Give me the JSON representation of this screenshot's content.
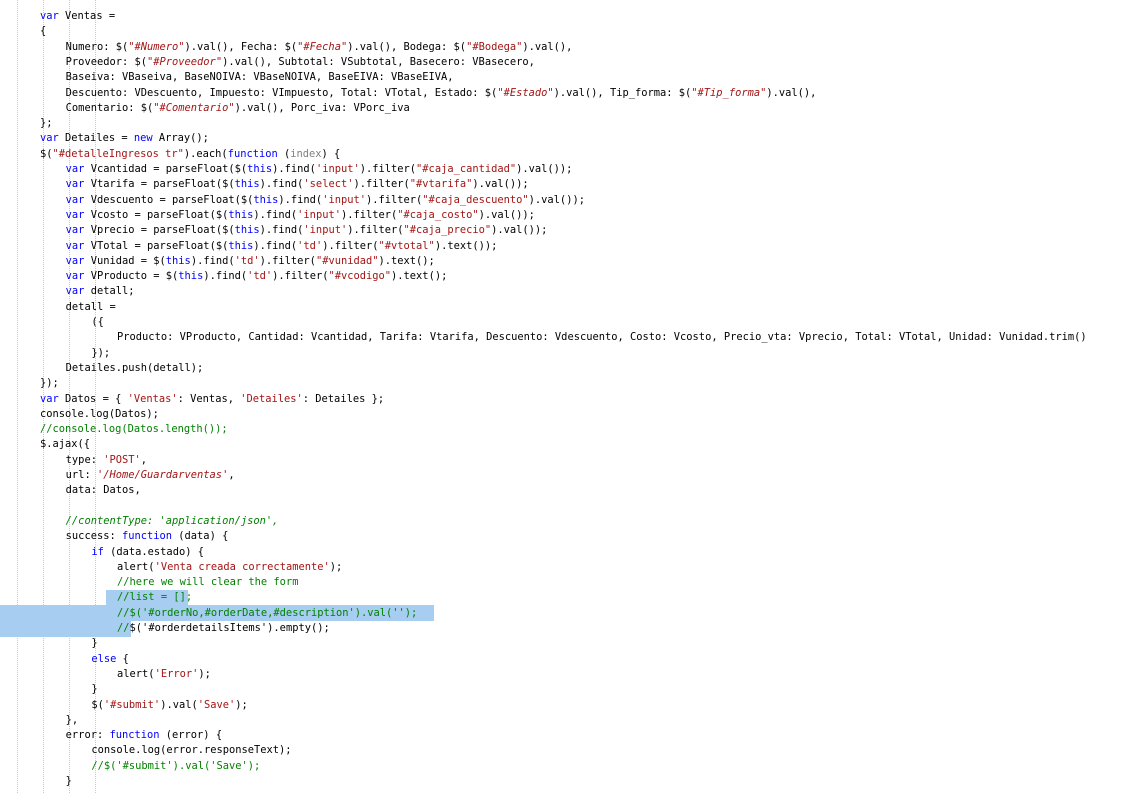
{
  "editor": {
    "language": "JavaScript",
    "colors": {
      "keyword": "#0000ff",
      "string": "#a31515",
      "comment": "#008000",
      "selection": "#a7cdf0",
      "background": "#ffffff"
    },
    "lines": [
      {
        "indent": 0,
        "t": [
          [
            "kw",
            "var"
          ],
          [
            "p",
            " Ventas ="
          ]
        ]
      },
      {
        "indent": 0,
        "t": [
          [
            "p",
            "{"
          ]
        ]
      },
      {
        "indent": 4,
        "t": [
          [
            "p",
            "Numero: $("
          ],
          [
            "sty",
            "\"#Numero\""
          ],
          [
            "p",
            ").val(), Fecha: $("
          ],
          [
            "sty",
            "\"#Fecha\""
          ],
          [
            "p",
            ").val(), Bodega: $("
          ],
          [
            "str",
            "\"#Bodega\""
          ],
          [
            "p",
            ").val(),"
          ]
        ]
      },
      {
        "indent": 4,
        "t": [
          [
            "p",
            "Proveedor: $("
          ],
          [
            "sty",
            "\"#Proveedor\""
          ],
          [
            "p",
            ").val(), Subtotal: VSubtotal, Basecero: VBasecero,"
          ]
        ]
      },
      {
        "indent": 4,
        "t": [
          [
            "p",
            "Baseiva: VBaseiva, BaseNOIVA: VBaseNOIVA, BaseEIVA: VBaseEIVA,"
          ]
        ]
      },
      {
        "indent": 4,
        "t": [
          [
            "p",
            "Descuento: VDescuento, Impuesto: VImpuesto, Total: VTotal, Estado: $("
          ],
          [
            "sty",
            "\"#Estado\""
          ],
          [
            "p",
            ").val(), Tip_forma: $("
          ],
          [
            "sty",
            "\"#Tip_forma\""
          ],
          [
            "p",
            ").val(),"
          ]
        ]
      },
      {
        "indent": 4,
        "t": [
          [
            "p",
            "Comentario: $("
          ],
          [
            "sty",
            "\"#Comentario\""
          ],
          [
            "p",
            ").val(), Porc_iva: VPorc_iva"
          ]
        ]
      },
      {
        "indent": 0,
        "t": [
          [
            "p",
            "};"
          ]
        ]
      },
      {
        "indent": 0,
        "t": [
          [
            "kw",
            "var"
          ],
          [
            "p",
            " Detailes = "
          ],
          [
            "kw",
            "new"
          ],
          [
            "p",
            " Array();"
          ]
        ]
      },
      {
        "indent": 0,
        "t": [
          [
            "p",
            "$("
          ],
          [
            "str",
            "\"#detalleIngresos tr\""
          ],
          [
            "p",
            ").each("
          ],
          [
            "kw",
            "function"
          ],
          [
            "p",
            " ("
          ],
          [
            "par",
            "index"
          ],
          [
            "p",
            ") {"
          ]
        ]
      },
      {
        "indent": 4,
        "t": [
          [
            "kw",
            "var"
          ],
          [
            "p",
            " Vcantidad = parseFloat($("
          ],
          [
            "kw",
            "this"
          ],
          [
            "p",
            ").find("
          ],
          [
            "str",
            "'input'"
          ],
          [
            "p",
            ").filter("
          ],
          [
            "str",
            "\"#caja_cantidad\""
          ],
          [
            "p",
            ").val());"
          ]
        ]
      },
      {
        "indent": 4,
        "t": [
          [
            "kw",
            "var"
          ],
          [
            "p",
            " Vtarifa = parseFloat($("
          ],
          [
            "kw",
            "this"
          ],
          [
            "p",
            ").find("
          ],
          [
            "str",
            "'select'"
          ],
          [
            "p",
            ").filter("
          ],
          [
            "str",
            "\"#vtarifa\""
          ],
          [
            "p",
            ").val());"
          ]
        ]
      },
      {
        "indent": 4,
        "t": [
          [
            "kw",
            "var"
          ],
          [
            "p",
            " Vdescuento = parseFloat($("
          ],
          [
            "kw",
            "this"
          ],
          [
            "p",
            ").find("
          ],
          [
            "str",
            "'input'"
          ],
          [
            "p",
            ").filter("
          ],
          [
            "str",
            "\"#caja_descuento\""
          ],
          [
            "p",
            ").val());"
          ]
        ]
      },
      {
        "indent": 4,
        "t": [
          [
            "kw",
            "var"
          ],
          [
            "p",
            " Vcosto = parseFloat($("
          ],
          [
            "kw",
            "this"
          ],
          [
            "p",
            ").find("
          ],
          [
            "str",
            "'input'"
          ],
          [
            "p",
            ").filter("
          ],
          [
            "str",
            "\"#caja_costo\""
          ],
          [
            "p",
            ").val());"
          ]
        ]
      },
      {
        "indent": 4,
        "t": [
          [
            "kw",
            "var"
          ],
          [
            "p",
            " Vprecio = parseFloat($("
          ],
          [
            "kw",
            "this"
          ],
          [
            "p",
            ").find("
          ],
          [
            "str",
            "'input'"
          ],
          [
            "p",
            ").filter("
          ],
          [
            "str",
            "\"#caja_precio\""
          ],
          [
            "p",
            ").val());"
          ]
        ]
      },
      {
        "indent": 4,
        "t": [
          [
            "kw",
            "var"
          ],
          [
            "p",
            " VTotal = parseFloat($("
          ],
          [
            "kw",
            "this"
          ],
          [
            "p",
            ").find("
          ],
          [
            "str",
            "'td'"
          ],
          [
            "p",
            ").filter("
          ],
          [
            "str",
            "\"#vtotal\""
          ],
          [
            "p",
            ").text());"
          ]
        ]
      },
      {
        "indent": 4,
        "t": [
          [
            "kw",
            "var"
          ],
          [
            "p",
            " Vunidad = $("
          ],
          [
            "kw",
            "this"
          ],
          [
            "p",
            ").find("
          ],
          [
            "str",
            "'td'"
          ],
          [
            "p",
            ").filter("
          ],
          [
            "str",
            "\"#vunidad\""
          ],
          [
            "p",
            ").text();"
          ]
        ]
      },
      {
        "indent": 4,
        "t": [
          [
            "kw",
            "var"
          ],
          [
            "p",
            " VProducto = $("
          ],
          [
            "kw",
            "this"
          ],
          [
            "p",
            ").find("
          ],
          [
            "str",
            "'td'"
          ],
          [
            "p",
            ").filter("
          ],
          [
            "str",
            "\"#vcodigo\""
          ],
          [
            "p",
            ").text();"
          ]
        ]
      },
      {
        "indent": 4,
        "t": [
          [
            "kw",
            "var"
          ],
          [
            "p",
            " detall;"
          ]
        ]
      },
      {
        "indent": 4,
        "t": [
          [
            "p",
            "detall ="
          ]
        ]
      },
      {
        "indent": 8,
        "t": [
          [
            "p",
            "({"
          ]
        ]
      },
      {
        "indent": 12,
        "t": [
          [
            "p",
            "Producto: VProducto, Cantidad: Vcantidad, Tarifa: Vtarifa, Descuento: Vdescuento, Costo: Vcosto, Precio_vta: Vprecio, Total: VTotal, Unidad: Vunidad.trim()"
          ]
        ]
      },
      {
        "indent": 8,
        "t": [
          [
            "p",
            "});"
          ]
        ]
      },
      {
        "indent": 4,
        "t": [
          [
            "p",
            "Detailes.push(detall);"
          ]
        ]
      },
      {
        "indent": 0,
        "t": [
          [
            "p",
            "});"
          ]
        ]
      },
      {
        "indent": 0,
        "t": [
          [
            "kw",
            "var"
          ],
          [
            "p",
            " Datos = { "
          ],
          [
            "str",
            "'Ventas'"
          ],
          [
            "p",
            ": Ventas, "
          ],
          [
            "str",
            "'Detailes'"
          ],
          [
            "p",
            ": Detailes };"
          ]
        ]
      },
      {
        "indent": 0,
        "t": [
          [
            "p",
            "console.log(Datos);"
          ]
        ]
      },
      {
        "indent": 0,
        "t": [
          [
            "cm",
            "//console.log(Datos.length());"
          ]
        ]
      },
      {
        "indent": 0,
        "t": [
          [
            "p",
            "$.ajax({"
          ]
        ]
      },
      {
        "indent": 4,
        "t": [
          [
            "p",
            "type: "
          ],
          [
            "str",
            "'POST'"
          ],
          [
            "p",
            ","
          ]
        ]
      },
      {
        "indent": 4,
        "t": [
          [
            "p",
            "url: "
          ],
          [
            "sty",
            "'/Home/Guardarventas'"
          ],
          [
            "p",
            ","
          ]
        ]
      },
      {
        "indent": 4,
        "t": [
          [
            "p",
            "data: Datos,"
          ]
        ]
      },
      {
        "indent": 0,
        "t": []
      },
      {
        "indent": 4,
        "t": [
          [
            "cmi",
            "//contentType: 'application/json',"
          ]
        ]
      },
      {
        "indent": 4,
        "t": [
          [
            "p",
            "success: "
          ],
          [
            "kw",
            "function"
          ],
          [
            "p",
            " (data) {"
          ]
        ]
      },
      {
        "indent": 8,
        "t": [
          [
            "kw",
            "if"
          ],
          [
            "p",
            " (data.estado) {"
          ]
        ]
      },
      {
        "indent": 12,
        "t": [
          [
            "p",
            "alert("
          ],
          [
            "str",
            "'Venta creada correctamente'"
          ],
          [
            "p",
            ");"
          ]
        ]
      },
      {
        "indent": 12,
        "t": [
          [
            "cm",
            "//here we will clear the form"
          ]
        ]
      },
      {
        "indent": 12,
        "t": [
          [
            "cm",
            "//list = [];"
          ]
        ]
      },
      {
        "indent": 12,
        "t": [
          [
            "cm",
            "//$('#orderNo,#orderDate,#description').val('');"
          ]
        ]
      },
      {
        "indent": 12,
        "t": [
          [
            "cm",
            "//"
          ],
          [
            "p",
            "$('#orderdetailsItems').empty();"
          ]
        ]
      },
      {
        "indent": 8,
        "t": [
          [
            "p",
            "}"
          ]
        ]
      },
      {
        "indent": 8,
        "t": [
          [
            "kw",
            "else"
          ],
          [
            "p",
            " {"
          ]
        ]
      },
      {
        "indent": 12,
        "t": [
          [
            "p",
            "alert("
          ],
          [
            "str",
            "'Error'"
          ],
          [
            "p",
            ");"
          ]
        ]
      },
      {
        "indent": 8,
        "t": [
          [
            "p",
            "}"
          ]
        ]
      },
      {
        "indent": 8,
        "t": [
          [
            "p",
            "$("
          ],
          [
            "str",
            "'#submit'"
          ],
          [
            "p",
            ").val("
          ],
          [
            "str",
            "'Save'"
          ],
          [
            "p",
            ");"
          ]
        ]
      },
      {
        "indent": 4,
        "t": [
          [
            "p",
            "},"
          ]
        ]
      },
      {
        "indent": 4,
        "t": [
          [
            "p",
            "error: "
          ],
          [
            "kw",
            "function"
          ],
          [
            "p",
            " (error) {"
          ]
        ]
      },
      {
        "indent": 8,
        "t": [
          [
            "p",
            "console.log(error.responseText);"
          ]
        ]
      },
      {
        "indent": 8,
        "t": [
          [
            "cm",
            "//$('#submit').val('Save');"
          ]
        ]
      },
      {
        "indent": 4,
        "t": [
          [
            "p",
            "}"
          ]
        ]
      }
    ]
  }
}
